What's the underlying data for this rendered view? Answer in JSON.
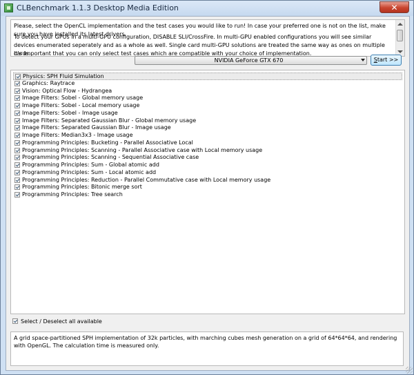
{
  "window": {
    "title": "CLBenchmark 1.1.3 Desktop Media Edition",
    "close_glyph": "✕"
  },
  "info": {
    "paragraph1": "Please, select the OpenCL implementation and the test cases you would like to run! In case your preferred one is not on the list, make sure you have installed its latest drivers.",
    "paragraph2": "To detect your GPUs in a multi-GPU configuration, DISABLE SLI/CrossFire. In multi-GPU enabled configurations you will see similar devices enumerated seperately and as a whole as well. Single card multi-GPU solutions are treated the same way as ones on multiple cards.",
    "paragraph3": "It's important that you can only select test cases which are compatible with your choice of implementation."
  },
  "device": {
    "selected": "NVIDIA GeForce GTX 670"
  },
  "start_button": {
    "label_underlined": "S",
    "label_rest": "tart >>"
  },
  "tests": [
    {
      "label": "Physics: SPH Fluid Simulation",
      "checked": true
    },
    {
      "label": "Graphics: Raytrace",
      "checked": true
    },
    {
      "label": "Vision: Optical Flow - Hydrangea",
      "checked": true
    },
    {
      "label": "Image Filters: Sobel - Global memory usage",
      "checked": true
    },
    {
      "label": "Image Filters: Sobel - Local memory usage",
      "checked": true
    },
    {
      "label": "Image Filters: Sobel - Image usage",
      "checked": true
    },
    {
      "label": "Image Filters: Separated Gaussian Blur - Global memory usage",
      "checked": true
    },
    {
      "label": "Image Filters: Separated Gaussian Blur - Image usage",
      "checked": true
    },
    {
      "label": "Image Filters: Median3x3 - Image usage",
      "checked": true
    },
    {
      "label": "Programming Principles: Bucketing - Parallel Associative Local",
      "checked": true
    },
    {
      "label": "Programming Principles: Scanning - Parallel Associative case with Local memory usage",
      "checked": true
    },
    {
      "label": "Programming Principles: Scanning - Sequential Associative case",
      "checked": true
    },
    {
      "label": "Programming Principles: Sum - Global atomic add",
      "checked": true
    },
    {
      "label": "Programming Principles: Sum - Local atomic add",
      "checked": true
    },
    {
      "label": "Programming Principles: Reduction - Parallel Commutative case with Local memory usage",
      "checked": true
    },
    {
      "label": "Programming Principles: Bitonic merge sort",
      "checked": true
    },
    {
      "label": "Programming Principles: Tree search",
      "checked": true
    }
  ],
  "select_all": {
    "label": "Select / Deselect all available",
    "checked": true
  },
  "description": "A grid space-partitioned SPH implementation of 32k particles, with marching cubes mesh generation on a grid of 64*64*64, and rendering with OpenGL. The calculation time is measured only."
}
